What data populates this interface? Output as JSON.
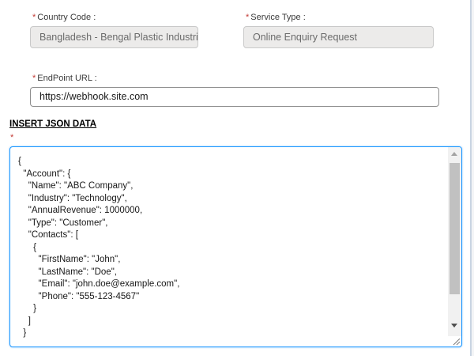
{
  "form": {
    "country_code": {
      "required_mark": "*",
      "label": "Country Code :",
      "value": "Bangladesh - Bengal Plastic Industries"
    },
    "service_type": {
      "required_mark": "*",
      "label": "Service Type :",
      "value": "Online Enquiry Request"
    },
    "endpoint_url": {
      "required_mark": "*",
      "label": "EndPoint URL :",
      "value": "https://webhook.site.com"
    }
  },
  "json_section": {
    "title": "INSERT JSON DATA",
    "required_mark": "*",
    "content": "{\n  \"Account\": {\n    \"Name\": \"ABC Company\",\n    \"Industry\": \"Technology\",\n    \"AnnualRevenue\": 1000000,\n    \"Type\": \"Customer\",\n    \"Contacts\": [\n      {\n        \"FirstName\": \"John\",\n        \"LastName\": \"Doe\",\n        \"Email\": \"john.doe@example.com\",\n        \"Phone\": \"555-123-4567\"\n      }\n    ]\n  }"
  },
  "icons": {
    "scroll_up": "triangle-up-icon",
    "scroll_down": "triangle-down-icon",
    "resize": "resize-grip-icon"
  },
  "colors": {
    "required": "#c23934",
    "focus_border": "#1b96ff",
    "disabled_bg": "#ecebea"
  }
}
